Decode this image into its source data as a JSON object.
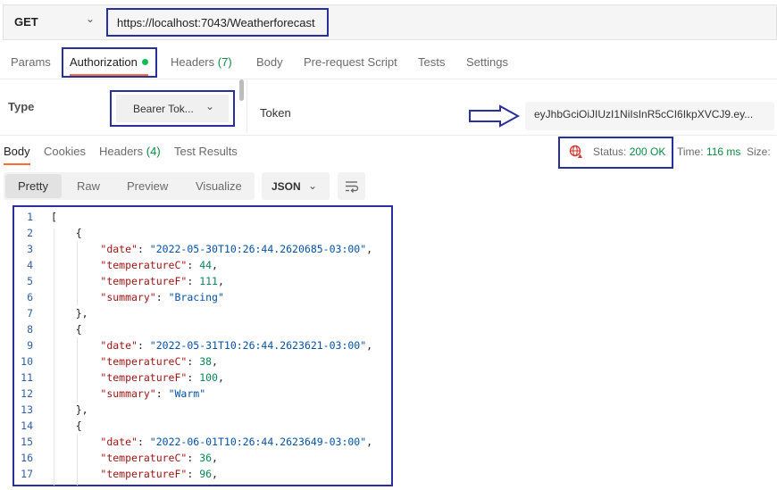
{
  "request": {
    "method": "GET",
    "url": "https://localhost:7043/Weatherforecast"
  },
  "request_tabs": [
    {
      "label": "Params"
    },
    {
      "label": "Authorization"
    },
    {
      "label": "Headers",
      "count": "(7)"
    },
    {
      "label": "Body"
    },
    {
      "label": "Pre-request Script"
    },
    {
      "label": "Tests"
    },
    {
      "label": "Settings"
    }
  ],
  "auth": {
    "type_label": "Type",
    "type_value": "Bearer Tok...",
    "token_label": "Token",
    "token_value": "eyJhbGciOiJIUzI1NiIsInR5cCI6IkpXVCJ9.ey..."
  },
  "response_tabs": [
    {
      "label": "Body"
    },
    {
      "label": "Cookies"
    },
    {
      "label": "Headers",
      "count": "(4)"
    },
    {
      "label": "Test Results"
    }
  ],
  "status": {
    "status_label": "Status:",
    "status_value": "200 OK",
    "time_label": "Time:",
    "time_value": "116 ms",
    "size_label": "Size:"
  },
  "view": {
    "modes": [
      "Pretty",
      "Raw",
      "Preview",
      "Visualize"
    ],
    "format": "JSON"
  },
  "code_lines": [
    "1",
    "2",
    "3",
    "4",
    "5",
    "6",
    "7",
    "8",
    "9",
    "10",
    "11",
    "12",
    "13",
    "14",
    "15",
    "16",
    "17"
  ],
  "json_body": [
    {
      "date": "2022-05-30T10:26:44.2620685-03:00",
      "temperatureC": "44",
      "temperatureF": "111",
      "summary": "Bracing"
    },
    {
      "date": "2022-05-31T10:26:44.2623621-03:00",
      "temperatureC": "38",
      "temperatureF": "100",
      "summary": "Warm"
    },
    {
      "date": "2022-06-01T10:26:44.2623649-03:00",
      "temperatureC": "36",
      "temperatureF": "96"
    }
  ],
  "colors": {
    "accent": "#ff6c37",
    "success": "#0c8a42",
    "annotation": "#2a2f9e"
  }
}
